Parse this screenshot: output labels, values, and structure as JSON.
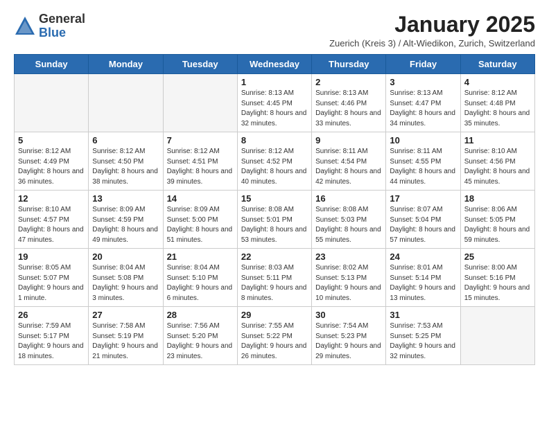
{
  "logo": {
    "general": "General",
    "blue": "Blue"
  },
  "title": "January 2025",
  "subtitle": "Zuerich (Kreis 3) / Alt-Wiedikon, Zurich, Switzerland",
  "days_of_week": [
    "Sunday",
    "Monday",
    "Tuesday",
    "Wednesday",
    "Thursday",
    "Friday",
    "Saturday"
  ],
  "weeks": [
    [
      {
        "day": "",
        "info": ""
      },
      {
        "day": "",
        "info": ""
      },
      {
        "day": "",
        "info": ""
      },
      {
        "day": "1",
        "info": "Sunrise: 8:13 AM\nSunset: 4:45 PM\nDaylight: 8 hours and 32 minutes."
      },
      {
        "day": "2",
        "info": "Sunrise: 8:13 AM\nSunset: 4:46 PM\nDaylight: 8 hours and 33 minutes."
      },
      {
        "day": "3",
        "info": "Sunrise: 8:13 AM\nSunset: 4:47 PM\nDaylight: 8 hours and 34 minutes."
      },
      {
        "day": "4",
        "info": "Sunrise: 8:12 AM\nSunset: 4:48 PM\nDaylight: 8 hours and 35 minutes."
      }
    ],
    [
      {
        "day": "5",
        "info": "Sunrise: 8:12 AM\nSunset: 4:49 PM\nDaylight: 8 hours and 36 minutes."
      },
      {
        "day": "6",
        "info": "Sunrise: 8:12 AM\nSunset: 4:50 PM\nDaylight: 8 hours and 38 minutes."
      },
      {
        "day": "7",
        "info": "Sunrise: 8:12 AM\nSunset: 4:51 PM\nDaylight: 8 hours and 39 minutes."
      },
      {
        "day": "8",
        "info": "Sunrise: 8:12 AM\nSunset: 4:52 PM\nDaylight: 8 hours and 40 minutes."
      },
      {
        "day": "9",
        "info": "Sunrise: 8:11 AM\nSunset: 4:54 PM\nDaylight: 8 hours and 42 minutes."
      },
      {
        "day": "10",
        "info": "Sunrise: 8:11 AM\nSunset: 4:55 PM\nDaylight: 8 hours and 44 minutes."
      },
      {
        "day": "11",
        "info": "Sunrise: 8:10 AM\nSunset: 4:56 PM\nDaylight: 8 hours and 45 minutes."
      }
    ],
    [
      {
        "day": "12",
        "info": "Sunrise: 8:10 AM\nSunset: 4:57 PM\nDaylight: 8 hours and 47 minutes."
      },
      {
        "day": "13",
        "info": "Sunrise: 8:09 AM\nSunset: 4:59 PM\nDaylight: 8 hours and 49 minutes."
      },
      {
        "day": "14",
        "info": "Sunrise: 8:09 AM\nSunset: 5:00 PM\nDaylight: 8 hours and 51 minutes."
      },
      {
        "day": "15",
        "info": "Sunrise: 8:08 AM\nSunset: 5:01 PM\nDaylight: 8 hours and 53 minutes."
      },
      {
        "day": "16",
        "info": "Sunrise: 8:08 AM\nSunset: 5:03 PM\nDaylight: 8 hours and 55 minutes."
      },
      {
        "day": "17",
        "info": "Sunrise: 8:07 AM\nSunset: 5:04 PM\nDaylight: 8 hours and 57 minutes."
      },
      {
        "day": "18",
        "info": "Sunrise: 8:06 AM\nSunset: 5:05 PM\nDaylight: 8 hours and 59 minutes."
      }
    ],
    [
      {
        "day": "19",
        "info": "Sunrise: 8:05 AM\nSunset: 5:07 PM\nDaylight: 9 hours and 1 minute."
      },
      {
        "day": "20",
        "info": "Sunrise: 8:04 AM\nSunset: 5:08 PM\nDaylight: 9 hours and 3 minutes."
      },
      {
        "day": "21",
        "info": "Sunrise: 8:04 AM\nSunset: 5:10 PM\nDaylight: 9 hours and 6 minutes."
      },
      {
        "day": "22",
        "info": "Sunrise: 8:03 AM\nSunset: 5:11 PM\nDaylight: 9 hours and 8 minutes."
      },
      {
        "day": "23",
        "info": "Sunrise: 8:02 AM\nSunset: 5:13 PM\nDaylight: 9 hours and 10 minutes."
      },
      {
        "day": "24",
        "info": "Sunrise: 8:01 AM\nSunset: 5:14 PM\nDaylight: 9 hours and 13 minutes."
      },
      {
        "day": "25",
        "info": "Sunrise: 8:00 AM\nSunset: 5:16 PM\nDaylight: 9 hours and 15 minutes."
      }
    ],
    [
      {
        "day": "26",
        "info": "Sunrise: 7:59 AM\nSunset: 5:17 PM\nDaylight: 9 hours and 18 minutes."
      },
      {
        "day": "27",
        "info": "Sunrise: 7:58 AM\nSunset: 5:19 PM\nDaylight: 9 hours and 21 minutes."
      },
      {
        "day": "28",
        "info": "Sunrise: 7:56 AM\nSunset: 5:20 PM\nDaylight: 9 hours and 23 minutes."
      },
      {
        "day": "29",
        "info": "Sunrise: 7:55 AM\nSunset: 5:22 PM\nDaylight: 9 hours and 26 minutes."
      },
      {
        "day": "30",
        "info": "Sunrise: 7:54 AM\nSunset: 5:23 PM\nDaylight: 9 hours and 29 minutes."
      },
      {
        "day": "31",
        "info": "Sunrise: 7:53 AM\nSunset: 5:25 PM\nDaylight: 9 hours and 32 minutes."
      },
      {
        "day": "",
        "info": ""
      }
    ]
  ]
}
